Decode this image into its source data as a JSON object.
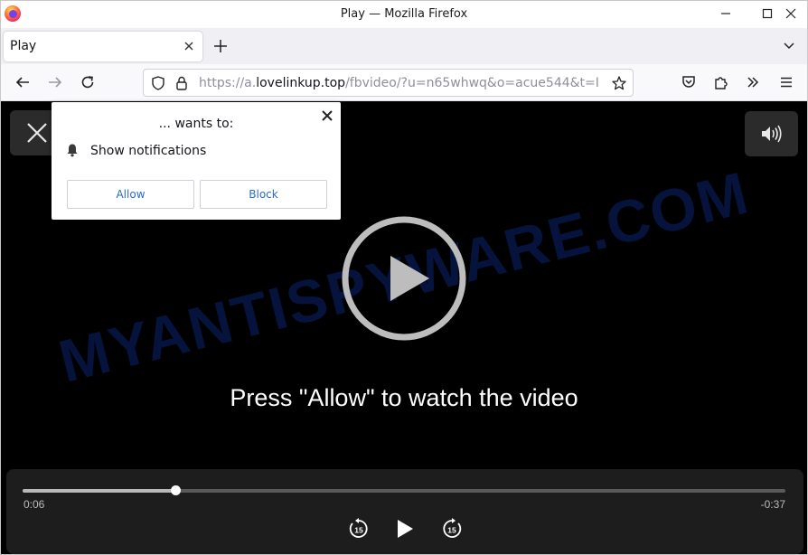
{
  "window": {
    "title": "Play — Mozilla Firefox"
  },
  "tabs": [
    {
      "label": "Play",
      "active": true
    }
  ],
  "address_bar": {
    "url_prefix": "https://a.",
    "url_domain": "lovelinkup.top",
    "url_suffix": "/fbvideo/?u=n65whwq&o=acue544&t=I"
  },
  "page": {
    "watermark": "MYANTISPYWARE.COM",
    "prompt": "Press \"Allow\" to watch the video"
  },
  "player": {
    "progress": 0.2,
    "elapsed": "0:06",
    "remaining": "-0:37",
    "skip_back_label": "15",
    "skip_forward_label": "15"
  },
  "notification_popup": {
    "heading": "... wants to:",
    "permission": "Show notifications",
    "allow_label": "Allow",
    "block_label": "Block"
  },
  "colors": {
    "accent": "#2a6cc4",
    "watermark": "#0a1f5e",
    "firefox_orange": "#ff7139"
  }
}
